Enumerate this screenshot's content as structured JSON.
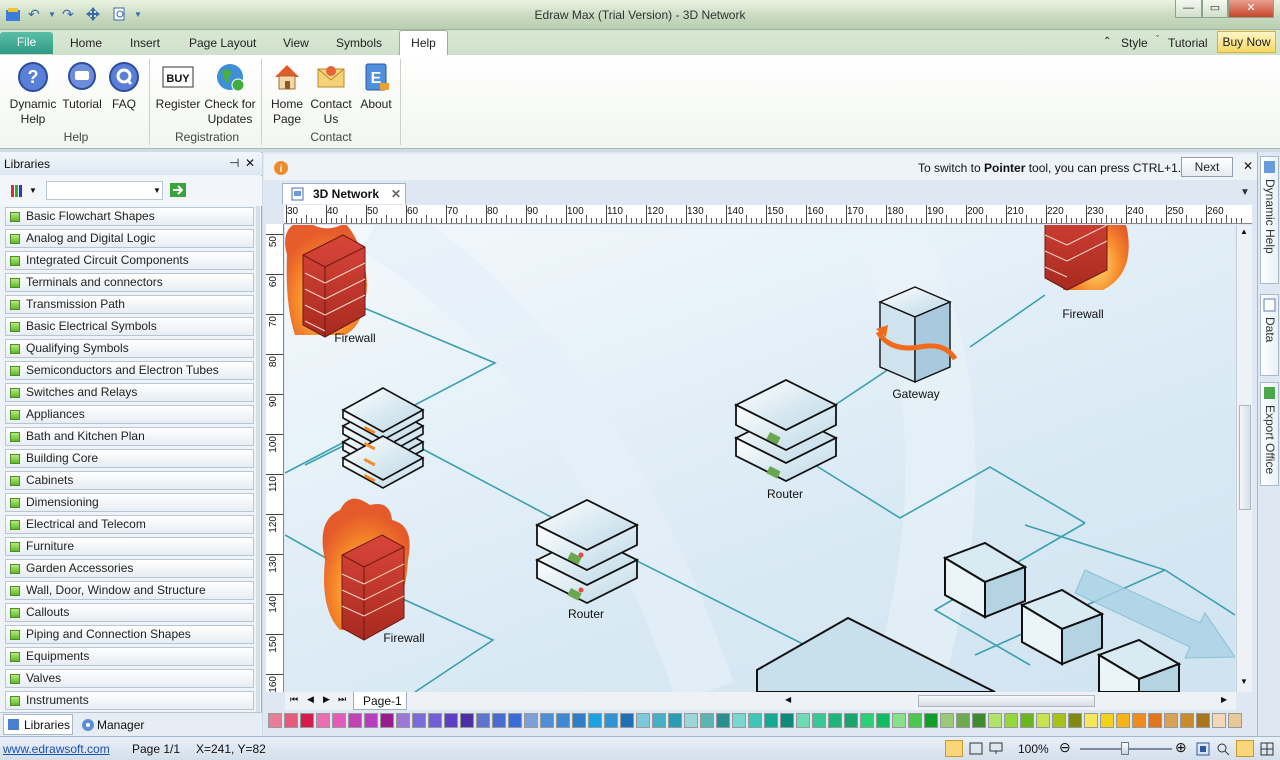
{
  "window": {
    "title": "Edraw Max (Trial Version) - 3D Network",
    "minimize": "—",
    "maximize": "▭",
    "close": "✕"
  },
  "quick_access": {
    "undo": "↶",
    "redo": "↷"
  },
  "tabs": {
    "file": "File",
    "home": "Home",
    "insert": "Insert",
    "page_layout": "Page Layout",
    "view": "View",
    "symbols": "Symbols",
    "help": "Help"
  },
  "ribbon_right": {
    "style": "Style",
    "tutorial": "Tutorial",
    "buy_now": "Buy Now"
  },
  "ribbon": {
    "groups": {
      "help": "Help",
      "registration": "Registration",
      "contact": "Contact"
    },
    "buttons": {
      "dynamic_help": "Dynamic Help",
      "tutorial": "Tutorial",
      "faq": "FAQ",
      "register": "Register",
      "check_updates": "Check for Updates",
      "home_page": "Home Page",
      "contact_us": "Contact Us",
      "about": "About"
    },
    "buy_icon_text": "BUY"
  },
  "libraries": {
    "title": "Libraries",
    "items": [
      "Basic Flowchart Shapes",
      "Analog and Digital Logic",
      "Integrated Circuit Components",
      "Terminals and connectors",
      "Transmission Path",
      "Basic Electrical Symbols",
      "Qualifying Symbols",
      "Semiconductors and Electron Tubes",
      "Switches and Relays",
      "Appliances",
      "Bath and Kitchen Plan",
      "Building Core",
      "Cabinets",
      "Dimensioning",
      "Electrical and Telecom",
      "Furniture",
      "Garden Accessories",
      "Wall, Door, Window and Structure",
      "Callouts",
      "Piping and Connection Shapes",
      "Equipments",
      "Valves",
      "Instruments"
    ],
    "bottom_tabs": {
      "libraries": "Libraries",
      "manager": "Manager"
    }
  },
  "infobar": {
    "prefix": "To switch to ",
    "bold": "Pointer",
    "suffix": " tool, you can press CTRL+1.",
    "next": "Next"
  },
  "document": {
    "tab": "3D Network",
    "page_tab": "Page-1"
  },
  "ruler": {
    "h_ticks": [
      "30",
      "40",
      "50",
      "60",
      "70",
      "80",
      "90",
      "100",
      "110",
      "120",
      "130",
      "140",
      "150",
      "160",
      "170",
      "180",
      "190",
      "200",
      "210",
      "220",
      "230",
      "240",
      "250",
      "260"
    ],
    "v_ticks": [
      "50",
      "60",
      "70",
      "80",
      "90",
      "100",
      "110",
      "120",
      "130",
      "140",
      "150",
      "160"
    ]
  },
  "diagram_labels": {
    "firewall_top": "Firewall",
    "firewall_right": "Firewall",
    "firewall_bottom": "Firewall",
    "gateway": "Gateway",
    "router_right": "Router",
    "router_center": "Router"
  },
  "right_dock": {
    "dynamic_help": "Dynamic Help",
    "data": "Data",
    "export_office": "Export Office"
  },
  "status": {
    "url": "www.edrawsoft.com",
    "page": "Page 1/1",
    "coords": "X=241, Y=82",
    "zoom": "100%"
  },
  "palette": [
    "#e87f9a",
    "#e65a7b",
    "#d81b4d",
    "#e86fb0",
    "#e45bb9",
    "#c343b5",
    "#b53ec2",
    "#9a1b8e",
    "#9b77d8",
    "#7a6cd8",
    "#7460d6",
    "#5d3fc6",
    "#4c2fa4",
    "#5d75cf",
    "#4a6bd3",
    "#3b6ad9",
    "#7f9fd8",
    "#4c8fd6",
    "#3d88d3",
    "#2f7ec7",
    "#19a3e3",
    "#2e95d2",
    "#1f6fb2",
    "#7ec8d9",
    "#46aec5",
    "#2a9cb4",
    "#9dd6d8",
    "#5bb3b3",
    "#2a8f8f",
    "#79d7cf",
    "#3ec7b8",
    "#14a895",
    "#0e8a7a",
    "#6edbb5",
    "#38c794",
    "#1fb47a",
    "#19a36d",
    "#2bcf77",
    "#0ebc62",
    "#88e08a",
    "#4cc752",
    "#0f9e2a",
    "#9ac877",
    "#6ea84f",
    "#3f8a2f",
    "#b2e36d",
    "#94d63b",
    "#6cb51e",
    "#c9e34f",
    "#a7c21b",
    "#808a12",
    "#f5e65b",
    "#f0d21c",
    "#f5b31a",
    "#f08c1c",
    "#e0751e",
    "#d6a356",
    "#c98c2a",
    "#a8761d",
    "#f2d7b8",
    "#e8c79a"
  ],
  "colors": {
    "accent": "#2f9a86",
    "link_line": "#3aa0b0",
    "fire": "#f26a1b"
  }
}
